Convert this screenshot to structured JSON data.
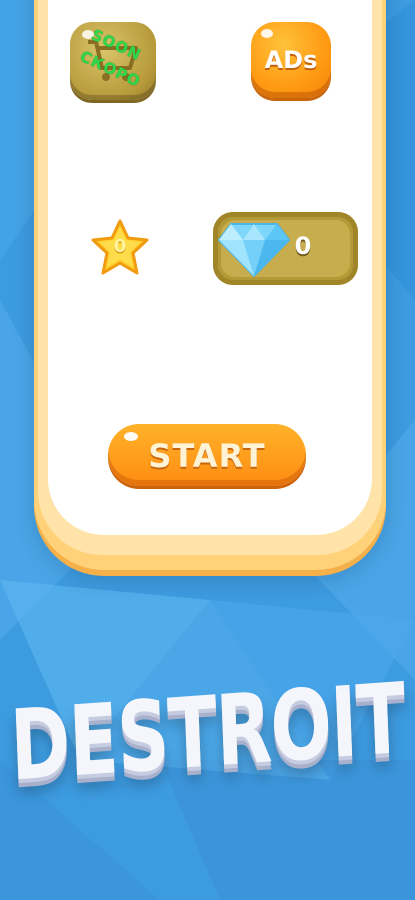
{
  "shop_button": {
    "soon_text_1": "SOON",
    "soon_text_2": "СКОРО",
    "icon": "shopping-cart-icon"
  },
  "ads_button": {
    "label": "ADs"
  },
  "stars": {
    "value": "0",
    "icon": "star-icon"
  },
  "gems": {
    "value": "0",
    "icon": "diamond-icon"
  },
  "start_button": {
    "label": "START"
  },
  "title": "DESTROIT",
  "colors": {
    "background": "#3d9be0",
    "panel_border": "#ffd27a",
    "accent_orange": "#ff9a12",
    "soon_green": "#2fd84a",
    "gem_box": "#b39a36"
  }
}
